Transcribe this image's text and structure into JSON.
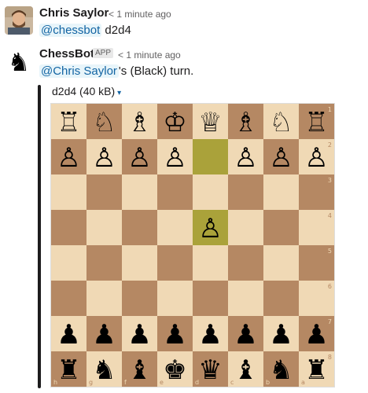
{
  "messages": [
    {
      "author": "Chris Saylor",
      "time": "< 1 minute ago",
      "mention": "@chessbot",
      "text": " d2d4"
    },
    {
      "author": "ChessBot",
      "badge": "APP",
      "time": "< 1 minute ago",
      "mention": "@Chris Saylor",
      "text": "'s (Black) turn.",
      "attachment": {
        "title": "d2d4 (40 kB)",
        "caret": "▾"
      }
    }
  ],
  "board": {
    "colors": {
      "light": "#f0d9b5",
      "dark": "#b58863",
      "highlight_light": "#cdd26a",
      "highlight_dark": "#aaa23a"
    },
    "highlight": [
      "d2",
      "d4"
    ],
    "rank_labels": [
      "1",
      "2",
      "3",
      "4",
      "5",
      "6",
      "7",
      "8"
    ],
    "file_labels": [
      "h",
      "g",
      "f",
      "e",
      "d",
      "c",
      "b",
      "a"
    ],
    "rows": [
      [
        "♖",
        "♘",
        "♗",
        "♔",
        "♕",
        "♗",
        "♘",
        "♖"
      ],
      [
        "♙",
        "♙",
        "♙",
        "♙",
        "",
        "♙",
        "♙",
        "♙"
      ],
      [
        "",
        "",
        "",
        "",
        "",
        "",
        "",
        ""
      ],
      [
        "",
        "",
        "",
        "",
        "♙",
        "",
        "",
        ""
      ],
      [
        "",
        "",
        "",
        "",
        "",
        "",
        "",
        ""
      ],
      [
        "",
        "",
        "",
        "",
        "",
        "",
        "",
        ""
      ],
      [
        "♟",
        "♟",
        "♟",
        "♟",
        "♟",
        "♟",
        "♟",
        "♟"
      ],
      [
        "♜",
        "♞",
        "♝",
        "♚",
        "♛",
        "♝",
        "♞",
        "♜"
      ]
    ]
  }
}
